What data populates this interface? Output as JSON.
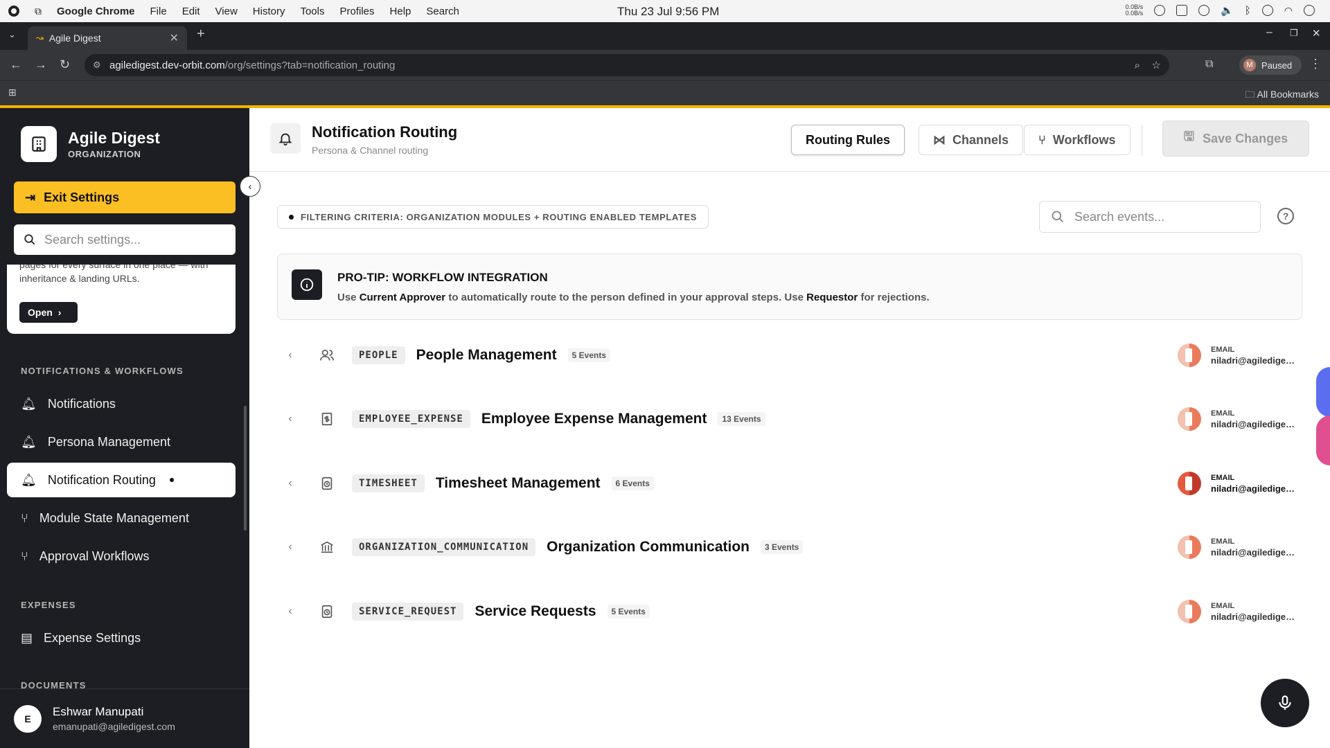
{
  "os": {
    "app_name": "Google Chrome",
    "menus": [
      "File",
      "Edit",
      "View",
      "History",
      "Tools",
      "Profiles",
      "Help",
      "Search"
    ],
    "clock": "Thu 23 Jul  9:56 PM",
    "net_up": "0.0B/s",
    "net_down": "0.0B/s"
  },
  "browser": {
    "tab_title": "Agile Digest",
    "url_host": "agiledigest.dev-orbit.com",
    "url_path": "/org/settings?tab=notification_routing",
    "profile_initial": "M",
    "profile_status": "Paused",
    "bookmarks_label": "All Bookmarks"
  },
  "sidebar": {
    "org_name": "Agile Digest",
    "org_type": "ORGANIZATION",
    "exit_label": "Exit Settings",
    "search_placeholder": "Search settings...",
    "promo_text": "pages for every surface in one place — with inheritance & landing URLs.",
    "promo_open": "Open",
    "section_notifications": "NOTIFICATIONS & WORKFLOWS",
    "items": [
      {
        "label": "Notifications"
      },
      {
        "label": "Persona Management"
      },
      {
        "label": "Notification Routing"
      },
      {
        "label": "Module State Management"
      },
      {
        "label": "Approval Workflows"
      }
    ],
    "section_expenses": "EXPENSES",
    "expense_item": "Expense Settings",
    "section_documents": "DOCUMENTS",
    "user_initial": "E",
    "user_name": "Eshwar Manupati",
    "user_email": "emanupati@agiledigest.com"
  },
  "header": {
    "title": "Notification Routing",
    "subtitle": "Persona & Channel routing",
    "tab_rules": "Routing Rules",
    "tab_channels": "Channels",
    "tab_workflows": "Workflows",
    "save_label": "Save Changes"
  },
  "filter": {
    "criteria": "FILTERING CRITERIA: ORGANIZATION MODULES + ROUTING ENABLED TEMPLATES",
    "search_placeholder": "Search events..."
  },
  "tip": {
    "heading": "PRO-TIP: WORKFLOW INTEGRATION",
    "text_1": "Use ",
    "bold_1": "Current Approver",
    "text_2": " to automatically route to the person defined in your approval steps. Use ",
    "bold_2": "Requestor",
    "text_3": " for rejections."
  },
  "modules": [
    {
      "code": "PEOPLE",
      "title": "People Management",
      "count": "5 Events",
      "channel": "EMAIL",
      "recipient": "niladri@agiledigest.com",
      "icon": "people-icon"
    },
    {
      "code": "EMPLOYEE_EXPENSE",
      "title": "Employee Expense Management",
      "count": "13 Events",
      "channel": "EMAIL",
      "recipient": "niladri@agiledigest.com",
      "icon": "receipt-icon"
    },
    {
      "code": "TIMESHEET",
      "title": "Timesheet Management",
      "count": "6 Events",
      "channel": "EMAIL",
      "recipient": "niladri@agiledigest.com",
      "icon": "clock-icon"
    },
    {
      "code": "ORGANIZATION_COMMUNICATION",
      "title": "Organization Communication",
      "count": "3 Events",
      "channel": "EMAIL",
      "recipient": "niladri@agiledigest.com",
      "icon": "building-icon"
    },
    {
      "code": "SERVICE_REQUEST",
      "title": "Service Requests",
      "count": "5 Events",
      "channel": "EMAIL",
      "recipient": "niladri@agiledigest.com",
      "icon": "service-icon"
    }
  ],
  "colors": {
    "accent": "#fbbf24",
    "sidebar": "#1c1e23"
  }
}
